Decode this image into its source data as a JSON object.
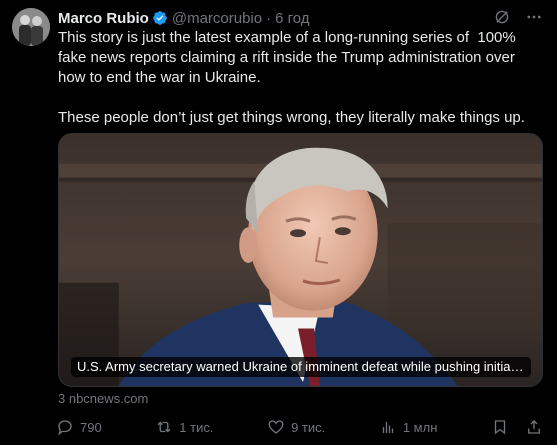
{
  "author": {
    "name": "Marco Rubio",
    "handle": "@marcorubio",
    "separator": "·",
    "time": "6 год"
  },
  "tweet": {
    "text": "This story is just the latest example of a long-running series of  100% fake news reports claiming a rift inside the Trump administration over how to end the war in Ukraine.\n\nThese people don’t just get things wrong, they literally make things up."
  },
  "card": {
    "caption": "U.S. Army secretary warned Ukraine of imminent defeat while pushing initial p...",
    "source": "3 nbcnews.com"
  },
  "actions": {
    "replies": "790",
    "reposts": "1 тис.",
    "likes": "9 тис.",
    "views": "1 млн"
  },
  "colors": {
    "background": "#000000",
    "text": "#e7e9ea",
    "muted": "#71767b",
    "verified": "#1d9bf0"
  },
  "icons": [
    "verified-badge-icon",
    "grok-icon",
    "more-icon",
    "reply-icon",
    "repost-icon",
    "like-icon",
    "views-icon",
    "bookmark-icon",
    "share-icon"
  ]
}
